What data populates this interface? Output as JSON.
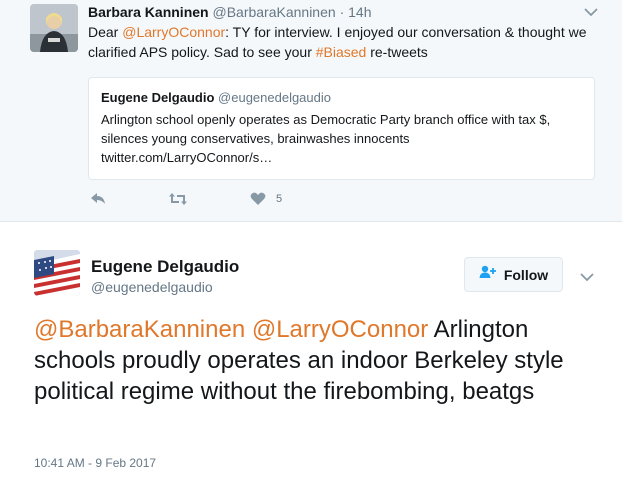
{
  "reply": {
    "name": "Barbara Kanninen",
    "handle": "@BarbaraKanninen",
    "separator": "·",
    "time": "14h",
    "text_parts": {
      "p1": "Dear ",
      "mention": "@LarryOConnor",
      "p2": ": TY for interview. I enjoyed our conversation & thought we clarified APS policy. Sad to see your ",
      "hashtag": "#Biased",
      "p3": " re-tweets"
    },
    "quote": {
      "name": "Eugene Delgaudio",
      "handle": "@eugenedelgaudio",
      "text": "Arlington school openly operates as Democratic Party branch office with tax $, silences young conservatives, brainwashes innocents",
      "link": "twitter.com/LarryOConnor/s…"
    },
    "like_count": "5"
  },
  "main": {
    "name": "Eugene Delgaudio",
    "handle": "@eugenedelgaudio",
    "follow_label": "Follow",
    "mention1": "@BarbaraKanninen",
    "mention2": "@LarryOConnor",
    "text": "Arlington schools proudly operates an indoor Berkeley style political regime without the firebombing, beatgs",
    "timestamp": "10:41 AM - 9 Feb 2017"
  },
  "colors": {
    "link": "#e0782b",
    "secondary_text": "#657786",
    "background_reply": "#f5f8fa",
    "border": "#e1e8ed"
  },
  "icons": [
    "chevron-down-icon",
    "reply-icon",
    "retweet-icon",
    "heart-icon",
    "follow-user-icon"
  ]
}
